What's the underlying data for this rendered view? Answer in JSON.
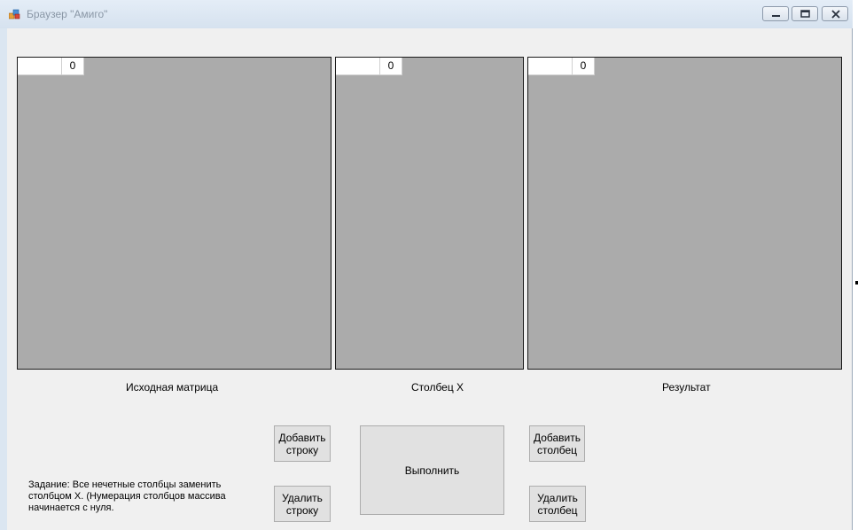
{
  "window": {
    "title": "Браузер \"Амиго\"",
    "app_icon": "app-icon",
    "controls": [
      "minimize-icon",
      "restore-icon",
      "close-icon"
    ]
  },
  "grids": {
    "source": {
      "header_value": "0",
      "caption": "Исходная матрица"
    },
    "column_x": {
      "header_value": "0",
      "caption": "Столбец X"
    },
    "result": {
      "header_value": "0",
      "caption": "Результат"
    }
  },
  "buttons": {
    "add_row": "Добавить строку",
    "delete_row": "Удалить строку",
    "execute": "Выполнить",
    "add_column": "Добавить столбец",
    "delete_column": "Удалить столбец"
  },
  "task_text": "Задание: Все нечетные столбцы заменить столбцом X. (Нумерация столбцов массива начинается с нуля.",
  "colors": {
    "grid_background": "#ababab",
    "client_background": "#f0f0f0",
    "button_face": "#e1e1e1",
    "titlebar": "#dbe6f1"
  }
}
